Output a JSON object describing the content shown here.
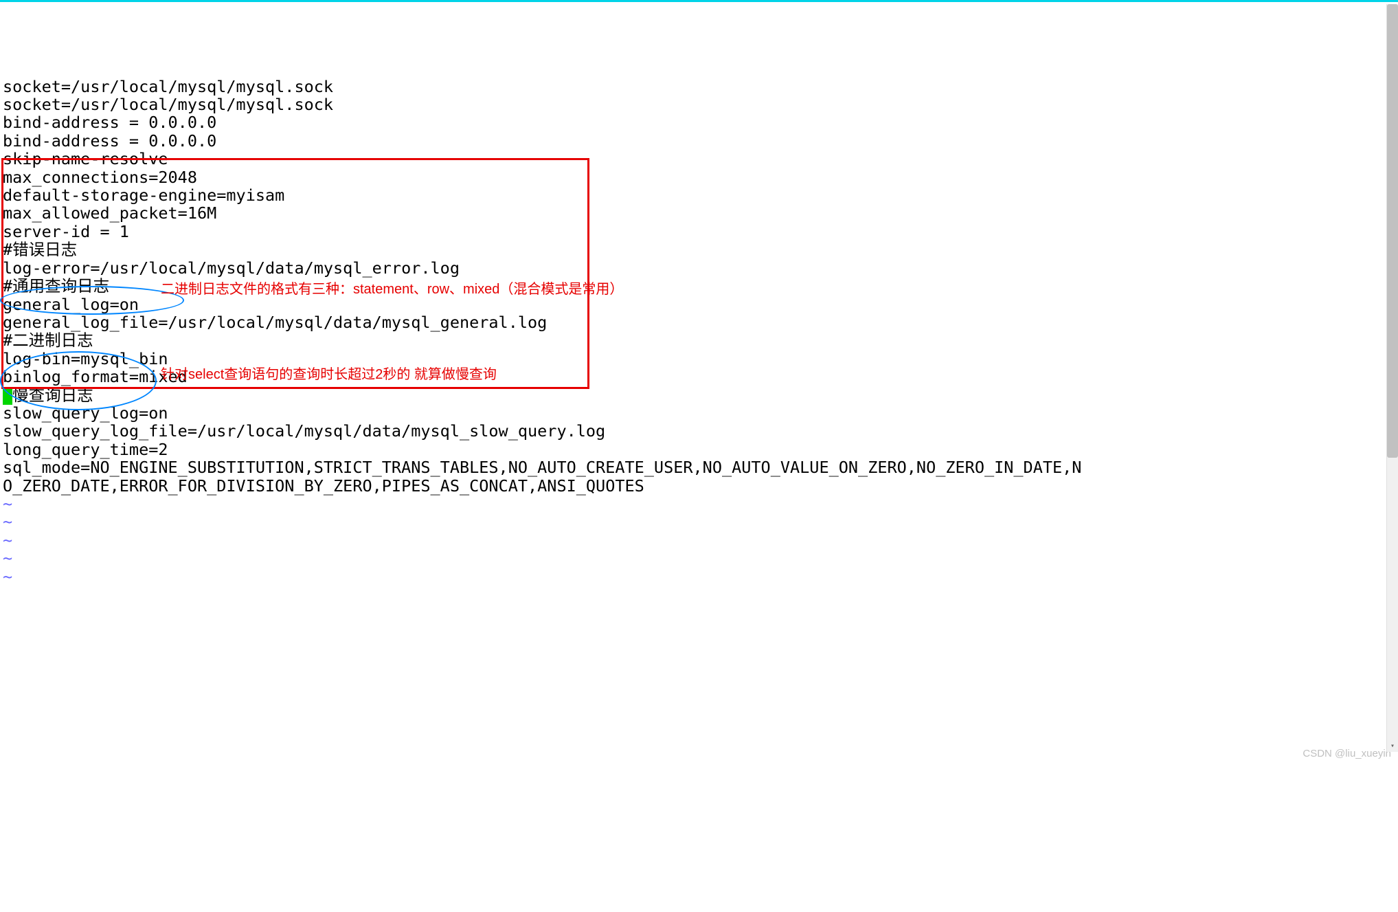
{
  "config": {
    "lines": [
      "socket=/usr/local/mysql/mysql.sock",
      "socket=/usr/local/mysql/mysql.sock",
      "bind-address = 0.0.0.0",
      "bind-address = 0.0.0.0",
      "skip-name-resolve",
      "max_connections=2048",
      "default-storage-engine=myisam",
      "max_allowed_packet=16M",
      "server-id = 1",
      "#错误日志",
      "log-error=/usr/local/mysql/data/mysql_error.log",
      "#通用查询日志",
      "general_log=on",
      "general_log_file=/usr/local/mysql/data/mysql_general.log",
      "#二进制日志",
      "log-bin=mysql_bin",
      "binlog_format=mixed",
      "#慢查询日志",
      "slow_query_log=on",
      "slow_query_log_file=/usr/local/mysql/data/mysql_slow_query.log",
      "long_query_time=2",
      "",
      "",
      "sql_mode=NO_ENGINE_SUBSTITUTION,STRICT_TRANS_TABLES,NO_AUTO_CREATE_USER,NO_AUTO_VALUE_ON_ZERO,NO_ZERO_IN_DATE,N",
      "O_ZERO_DATE,ERROR_FOR_DIVISION_BY_ZERO,PIPES_AS_CONCAT,ANSI_QUOTES"
    ],
    "tildes": [
      "~",
      "~",
      "~",
      "~",
      "~"
    ]
  },
  "annotations": {
    "binlog_note": "二进制日志文件的格式有三种：statement、row、mixed（混合模式是常用）",
    "slow_note": "针对select查询语句的查询时长超过2秒的 就算做慢查询"
  },
  "watermark": "CSDN @liu_xueyin"
}
